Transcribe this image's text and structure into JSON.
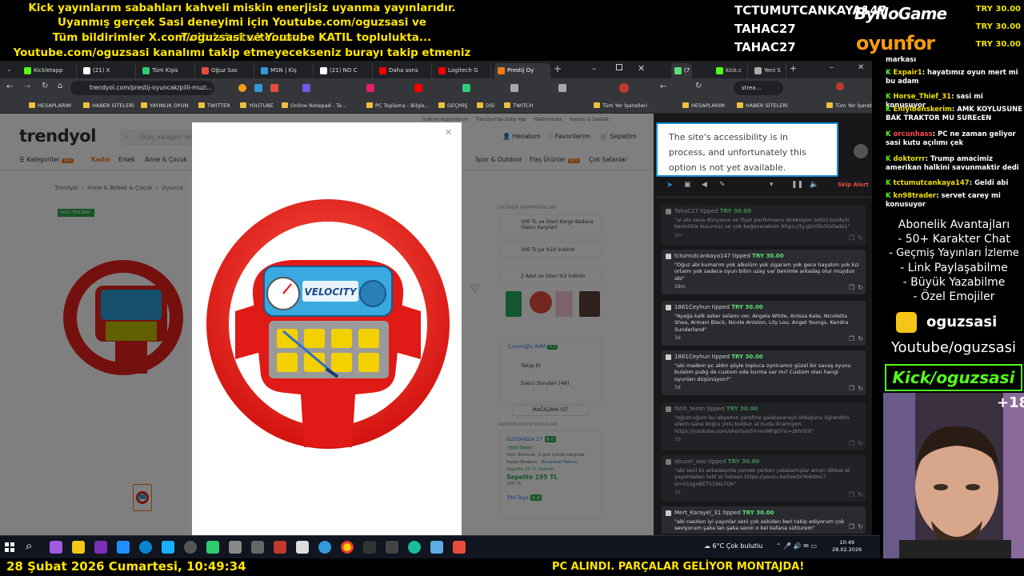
{
  "ticker": {
    "line1": "Kick yayınlarım sabahları kahveli miskin enerjisiz uyanma yayınlarıdır.",
    "line2": "Uyanmış gerçek Sasi deneyimi için Youtube.com/oguzsasi ve Twitch.tv/twitchsasi",
    "line3": "Tüm bildirimler X.com/oguzsasi ve Youtube KATIL toplulukta...",
    "line4": "Youtube.com/oguzsasi kanalımı takip etmeyecekseniz burayı takip etmeniz boş!"
  },
  "top_donors": {
    "line1": "TCTUMUTCANKAYA147",
    "line2": "TAHAC27",
    "line3": "TAHAC27",
    "amount1": "TRY 30.00",
    "amount2": "TRY 30.00",
    "amount3": "TRY 30.00",
    "logo1": "ByNoGame",
    "logo2": "oyunfor"
  },
  "browser": {
    "tabs": [
      "Kickletapp",
      "(21) X",
      "Tüm Kişis",
      "Oğuz Sas",
      "MSN | Kiş",
      "(21) NO C",
      "Daha sons",
      "Logitech G",
      "Prestij Oy"
    ],
    "url": "trendyol.com/prestij-oyuncak/pilli-muzi...",
    "bookmarks": [
      "HESAPLARIM",
      "HABER SİTELERİ",
      "YAYINLIK OYUN",
      "TWITTER",
      "YOUTUBE",
      "Online Notepad - Ta...",
      "PC Toplama - Bilgis...",
      "GEÇMİŞ",
      "DSİ",
      "TWITCH",
      "Tüm Yer İşaretleri"
    ]
  },
  "trendyol": {
    "logo": "trendyol",
    "top_links": [
      "İndirim Kuponlarım",
      "Trendyol'da Satış Yap",
      "Hakkımızda",
      "Yardım & Destek"
    ],
    "search_placeholder": "Ürün, kategori veya",
    "account": "Hesabım",
    "favorites": "Favorilerim",
    "cart": "Sepetim",
    "nav": [
      "Kategoriler",
      "Kadın",
      "Erkek",
      "Anne & Çocuk",
      "Spor & Outdoor",
      "Flaş Ürünler",
      "Çok Satanlar"
    ],
    "new_badge": "Yeni",
    "breadcrumb": [
      "Trendyol",
      "Anne & Bebek & Çocuk",
      "Oyunca"
    ],
    "fast_delivery": "HIZLI TESLİMAT",
    "campaigns_title": "ÜRÜNÜN KAMPANYALARI",
    "campaigns": [
      "300 TL ve Üzeri Kargo Bedava (Satıcı Karşılar)",
      "300 TL'ye %10 İndirim",
      "2 Adet ve Üzeri %3 İndirim"
    ],
    "seller_name": "Çınaroğlu AVM",
    "seller_score": "9.1",
    "follow": "Takip Et",
    "seller_questions": "Satıcı Soruları (49)",
    "store_button": "MAĞAZAYA GİT",
    "other_sellers": "ÜRÜNÜN DİĞER SATICILARI",
    "other_seller1": "ELEGANZA 27",
    "other_seller1_score": "8.0",
    "fast_seller": "Hızlı Satıcı",
    "fast_delivery_text": "Hızlı Teslimat:",
    "delivery_days": "2 gün içinde kargoda",
    "free_cargo": "Kargo Bedava",
    "corporate": "Kurumsal Fatura",
    "cart_discount": "Sepette 10 TL İndirim",
    "cart_price_label": "Sepette",
    "cart_price": "195 TL",
    "old_price": "205 TL",
    "other_seller2": "Trhl Toys",
    "other_seller2_score": "9.8"
  },
  "chat_browser": {
    "tabs": [
      "(7",
      "kick.c",
      "Yeni S"
    ],
    "url": "strea...",
    "bookmarks": [
      "HESAPLARIM",
      "HABER SİTELERİ",
      "Tüm Yer İşaretleri"
    ],
    "tooltip": "The site's accessibility is in process, and unfortunately this option is not yet available.",
    "skip_alert": "Skip Alert",
    "tipped_word": "tipped",
    "messages": [
      {
        "user": "TahaC27",
        "amount": "TRY 30.00",
        "text": "\"al abi sana dünyanın en fiyat performans direksiyon setini buldum kesinlikle kusursuz ve çok beğeneceksin https://ty.gl/c0fe30sfade1\"",
        "time": "2m",
        "dim": true
      },
      {
        "user": "tctumutcankaya147",
        "amount": "TRY 30.00",
        "text": "\"Oğuz abi kumarım yok alkolüm yok sigaram yok gece hayatım yok kız ortamı yok sadece oyun bilim uzay var benimle arkadaş olur muydun abi\"",
        "time": "28m",
        "dim": false
      },
      {
        "user": "1881Ceyhun",
        "amount": "TRY 30.00",
        "text": "\"Ayağa kalk asker selamı ver. Angela White, Anissa Kate, Nicoletta Shea, Armani Black, Nicole Aniston, Lily Lou, Angel Youngs, Kendra Sunderland\"",
        "time": "3d",
        "dim": false
      },
      {
        "user": "1881Ceyhun",
        "amount": "TRY 30.00",
        "text": "\"abi madem pc aldın şöyle topluca oynicamız güzel bir savaş oyunu bulalım pubg de custom oda kurma var mı? Custom olan hangi oyunları düşünüyon?\"",
        "time": "3d",
        "dim": false
      },
      {
        "user": "fatih_terim",
        "amount": "TRY 30.00",
        "text": "\"oğuzcuğum bu akşamın şerefine galatasaraylı olduğunu öğrendim aferin sana doğru yolu buldun al buda ikramiyen https://youtube.com/shorts/o5Y-mvMFqO?si=zblV5iX\"",
        "time": "3d",
        "dim": true
      },
      {
        "user": "abuzei_sasi",
        "amount": "TRY 30.00",
        "text": "\"abi seni kz arkadaşınla yemek yerken yakalamışlar aman dikkat et yayımladan telif at hemen https://youtu.be/lxeQVYo6dmc?si=01sgxBET52Wa7OX\"",
        "time": "3d",
        "dim": true
      },
      {
        "user": "Mert_Karayel_31",
        "amount": "TRY 30.00",
        "text": "\"abi nasılsın iyi yayınlar seni çok eskiden beri takip ediyorum çok seviyorum şaka lan şaka senin o kel kafana sütturem\"",
        "time": "",
        "dim": false
      }
    ]
  },
  "side_chat": [
    {
      "user": "",
      "text": "markası"
    },
    {
      "user": "Expair1",
      "text": ": hayatımız oyun mert mi bu adam"
    },
    {
      "user": "Horse_Thief_31",
      "text": ": sasi mi konuşuyor"
    },
    {
      "user": "Eniyibenskerim",
      "text": ": AMK KOYLUSUNE BAK TRAKTOR MU SUREcEN"
    },
    {
      "user": "orcunhass",
      "text": ": PC ne zaman geliyor sasi kutu açılımı çek"
    },
    {
      "user": "doktorrr",
      "text": ": Trump amacimiz amerikan halkini savunmaktir dedi"
    },
    {
      "user": "tctumutcankaya147",
      "text": ": Geldi abi"
    },
    {
      "user": "kn98trader",
      "text": ": servet carey mi konusuyor"
    }
  ],
  "benefits": [
    "Abonelik Avantajları",
    "- 50+ Karakter Chat",
    "- Geçmiş Yayınları İzleme",
    "- Link Paylaşabilme",
    "- Büyük Yazabilme",
    "- Özel Emojiler"
  ],
  "branding": {
    "channel": "oguzsasi",
    "youtube": "Youtube/oguzsasi",
    "kick": "Kick/oguzsasi",
    "plus": "+18"
  },
  "taskbar": {
    "weather": "6°C  Çok bulutlu",
    "time": "10:49",
    "date": "28.02.2026"
  },
  "bottom": {
    "datetime": "28 Şubat 2026 Cumartesi, 10:49:34",
    "notice": "PC ALINDI. PARÇALAR GELİYOR MONTAJDA!"
  },
  "colors": {
    "trendyol_orange": "#f27a1a",
    "ticker_yellow": "#ffe600",
    "kick_green": "#53fc18",
    "tip_green": "#5fe07a"
  }
}
